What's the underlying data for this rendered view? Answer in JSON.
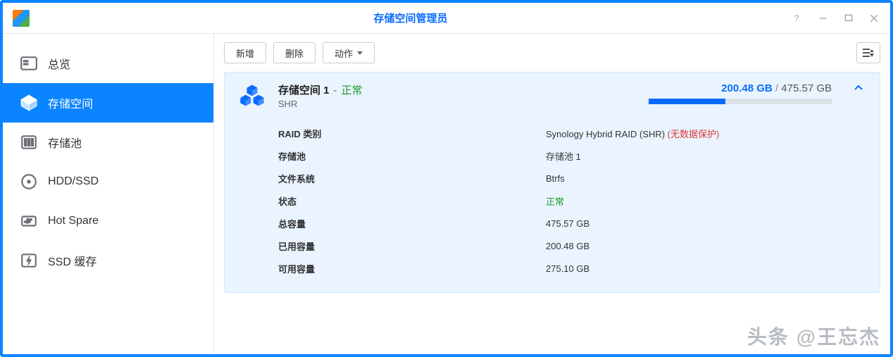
{
  "window": {
    "title": "存储空间管理员"
  },
  "sidebar": {
    "items": [
      {
        "id": "overview",
        "label": "总览",
        "icon": "overview-icon"
      },
      {
        "id": "volume",
        "label": "存储空间",
        "icon": "volume-icon",
        "active": true
      },
      {
        "id": "pool",
        "label": "存储池",
        "icon": "pool-icon"
      },
      {
        "id": "hdd",
        "label": "HDD/SSD",
        "icon": "hdd-icon"
      },
      {
        "id": "hotspare",
        "label": "Hot Spare",
        "icon": "hotspare-icon"
      },
      {
        "id": "ssdcache",
        "label": "SSD 缓存",
        "icon": "ssdcache-icon"
      }
    ]
  },
  "toolbar": {
    "create_label": "新增",
    "delete_label": "删除",
    "action_label": "动作"
  },
  "volume": {
    "name": "存储空间 1",
    "status_short": "正常",
    "type_short": "SHR",
    "usage": {
      "used": "200.48 GB",
      "total": "475.57 GB",
      "pct": 42
    },
    "details": [
      {
        "key": "RAID 类别",
        "value": "Synology Hybrid RAID (SHR)",
        "warn": "(无数据保护)"
      },
      {
        "key": "存储池",
        "value": "存储池 1"
      },
      {
        "key": "文件系统",
        "value": "Btrfs"
      },
      {
        "key": "状态",
        "value": "正常",
        "ok": true
      },
      {
        "key": "总容量",
        "value": "475.57 GB"
      },
      {
        "key": "已用容量",
        "value": "200.48 GB"
      },
      {
        "key": "可用容量",
        "value": "275.10 GB"
      }
    ]
  },
  "watermark": "头条 @王忘杰"
}
